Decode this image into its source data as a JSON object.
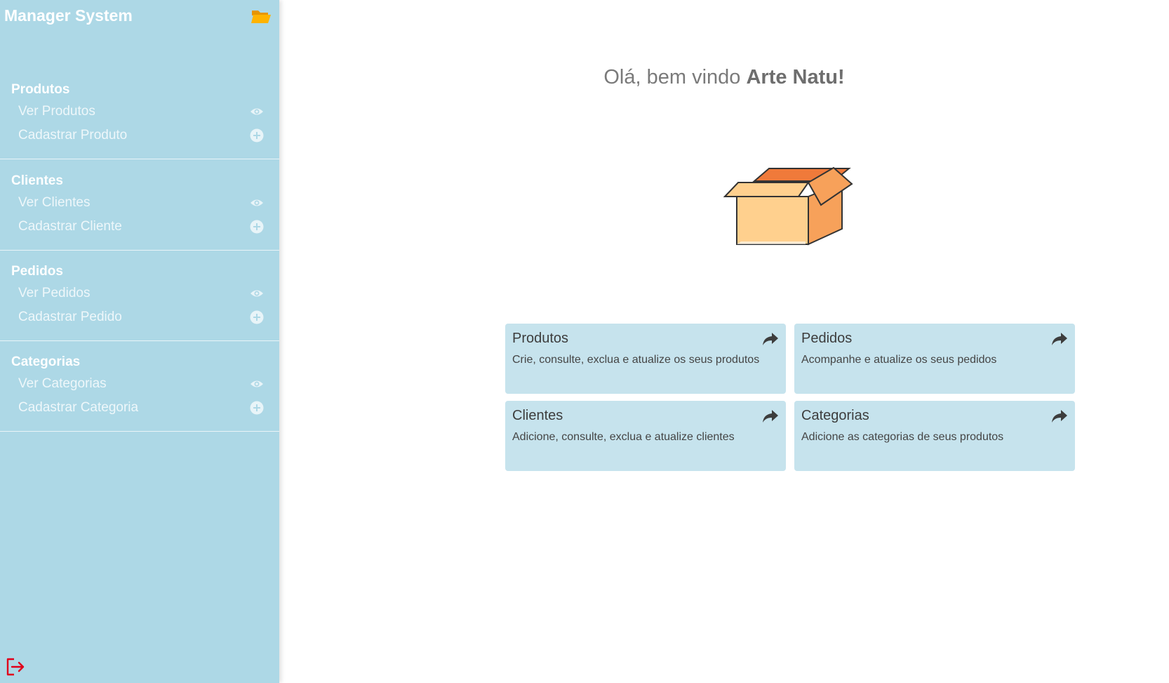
{
  "app": {
    "title": "Manager System"
  },
  "sidebar": {
    "sections": [
      {
        "title": "Produtos",
        "items": [
          {
            "label": "Ver Produtos",
            "icon": "eye-icon"
          },
          {
            "label": "Cadastrar Produto",
            "icon": "plus-circle-icon"
          }
        ]
      },
      {
        "title": "Clientes",
        "items": [
          {
            "label": "Ver Clientes",
            "icon": "eye-icon"
          },
          {
            "label": "Cadastrar Cliente",
            "icon": "plus-circle-icon"
          }
        ]
      },
      {
        "title": "Pedidos",
        "items": [
          {
            "label": "Ver Pedidos",
            "icon": "eye-icon"
          },
          {
            "label": "Cadastrar Pedido",
            "icon": "plus-circle-icon"
          }
        ]
      },
      {
        "title": "Categorias",
        "items": [
          {
            "label": "Ver Categorias",
            "icon": "eye-icon"
          },
          {
            "label": "Cadastrar Categoria",
            "icon": "plus-circle-icon"
          }
        ]
      }
    ]
  },
  "main": {
    "greeting": "Olá, bem vindo",
    "user_name": "Arte Natu!",
    "cards": [
      {
        "title": "Produtos",
        "description": "Crie, consulte, exclua e atualize os seus produtos"
      },
      {
        "title": "Pedidos",
        "description": "Acompanhe e atualize os seus pedidos"
      },
      {
        "title": "Clientes",
        "description": "Adicione, consulte, exclua e atualize clientes"
      },
      {
        "title": "Categorias",
        "description": "Adicione as categorias de seus produtos"
      }
    ]
  },
  "colors": {
    "sidebar_bg": "#add8e6",
    "card_bg": "#c6e3ed",
    "logout": "#e0001b",
    "folder": "#ffa000"
  }
}
